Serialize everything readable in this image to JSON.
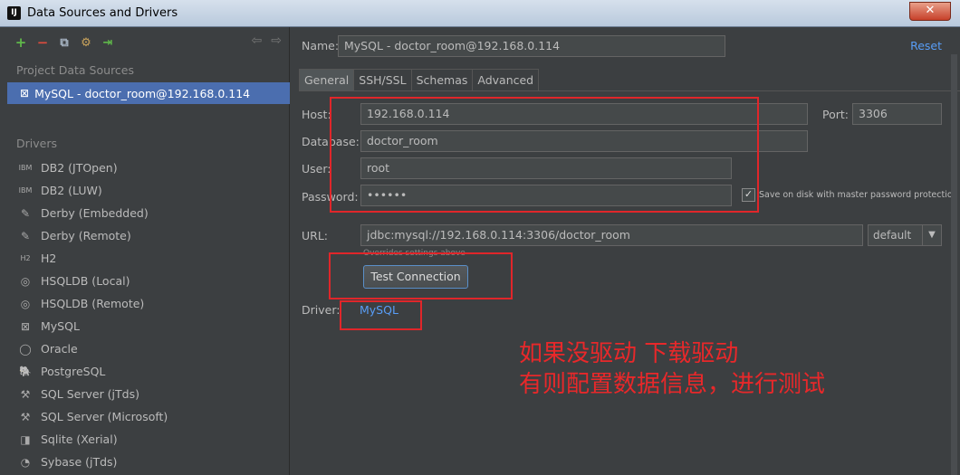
{
  "window": {
    "icon": "IJ",
    "title": "Data Sources and Drivers",
    "close_label": "✕"
  },
  "left": {
    "toolbar": [
      "add-icon",
      "remove-icon",
      "duplicate-icon",
      "settings-icon",
      "import-icon"
    ],
    "project_header": "Project Data Sources",
    "data_source": "MySQL - doctor_room@192.168.0.114",
    "drivers_header": "Drivers",
    "drivers": [
      {
        "icon": "IBM",
        "label": "DB2 (JTOpen)"
      },
      {
        "icon": "IBM",
        "label": "DB2 (LUW)"
      },
      {
        "icon": "✎",
        "label": "Derby (Embedded)"
      },
      {
        "icon": "✎",
        "label": "Derby (Remote)"
      },
      {
        "icon": "H2",
        "label": "H2"
      },
      {
        "icon": "◎",
        "label": "HSQLDB (Local)"
      },
      {
        "icon": "◎",
        "label": "HSQLDB (Remote)"
      },
      {
        "icon": "⊠",
        "label": "MySQL"
      },
      {
        "icon": "◯",
        "label": "Oracle"
      },
      {
        "icon": "🐘",
        "label": "PostgreSQL"
      },
      {
        "icon": "⚒",
        "label": "SQL Server (jTds)"
      },
      {
        "icon": "⚒",
        "label": "SQL Server (Microsoft)"
      },
      {
        "icon": "◨",
        "label": "Sqlite (Xerial)"
      },
      {
        "icon": "◔",
        "label": "Sybase (jTds)"
      }
    ]
  },
  "right": {
    "name_label": "Name:",
    "name_value": "MySQL - doctor_room@192.168.0.114",
    "reset": "Reset",
    "tabs": [
      "General",
      "SSH/SSL",
      "Schemas",
      "Advanced"
    ],
    "host_label": "Host:",
    "host_value": "192.168.0.114",
    "port_label": "Port:",
    "port_value": "3306",
    "database_label": "Database:",
    "database_value": "doctor_room",
    "user_label": "User:",
    "user_value": "root",
    "password_label": "Password:",
    "password_value": "••••••",
    "save_password": "Save on disk with master password protection",
    "url_label": "URL:",
    "url_value": "jdbc:mysql://192.168.0.114:3306/doctor_room",
    "url_mode": "default",
    "url_hint": "Overrides settings above",
    "test_button": "Test Connection",
    "driver_label": "Driver:",
    "driver_link": "MySQL"
  },
  "annotation": {
    "line1": "如果没驱动 下载驱动",
    "line2": "有则配置数据信息，进行测试",
    "color": "#e8282a"
  }
}
